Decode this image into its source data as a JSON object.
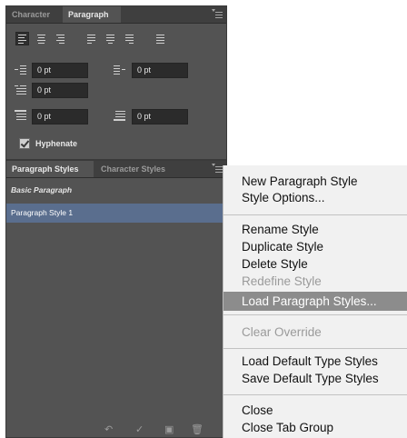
{
  "paragraph_panel": {
    "tabs": [
      {
        "label": "Character"
      },
      {
        "label": "Paragraph"
      }
    ],
    "active_tab": "Paragraph",
    "left_indent": "0 pt",
    "right_indent": "0 pt",
    "first_line_indent": "0 pt",
    "space_before": "0 pt",
    "space_after": "0 pt",
    "hyphenate_label": "Hyphenate",
    "hyphenate_checked": true
  },
  "styles_panel": {
    "tabs": [
      {
        "label": "Paragraph Styles"
      },
      {
        "label": "Character Styles"
      }
    ],
    "active_tab": "Paragraph Styles",
    "styles": [
      {
        "label": "Basic Paragraph"
      },
      {
        "label": "Paragraph Style 1"
      }
    ],
    "selected_style": "Paragraph Style 1",
    "footer_icons": [
      "undo-icon",
      "checkmark-icon",
      "new-style-icon",
      "trash-icon"
    ]
  },
  "context_menu": {
    "items": [
      {
        "label": "New Paragraph Style",
        "enabled": true
      },
      {
        "label": "Style Options...",
        "enabled": true
      },
      {
        "label": "Rename Style",
        "enabled": true
      },
      {
        "label": "Duplicate Style",
        "enabled": true
      },
      {
        "label": "Delete Style",
        "enabled": true
      },
      {
        "label": "Redefine Style",
        "enabled": false
      },
      {
        "label": "Load Paragraph Styles...",
        "enabled": true,
        "highlighted": true
      },
      {
        "label": "Clear Override",
        "enabled": false
      },
      {
        "label": "Load Default Type Styles",
        "enabled": true
      },
      {
        "label": "Save Default Type Styles",
        "enabled": true
      },
      {
        "label": "Close",
        "enabled": true
      },
      {
        "label": "Close Tab Group",
        "enabled": true
      }
    ]
  },
  "colors": {
    "panel_bg": "#535353",
    "tab_bar_bg": "#3f3f3f",
    "selection_bg": "#5a6e8e",
    "menu_bg": "#f1f1f1",
    "menu_highlight": "#8c8c8c"
  }
}
